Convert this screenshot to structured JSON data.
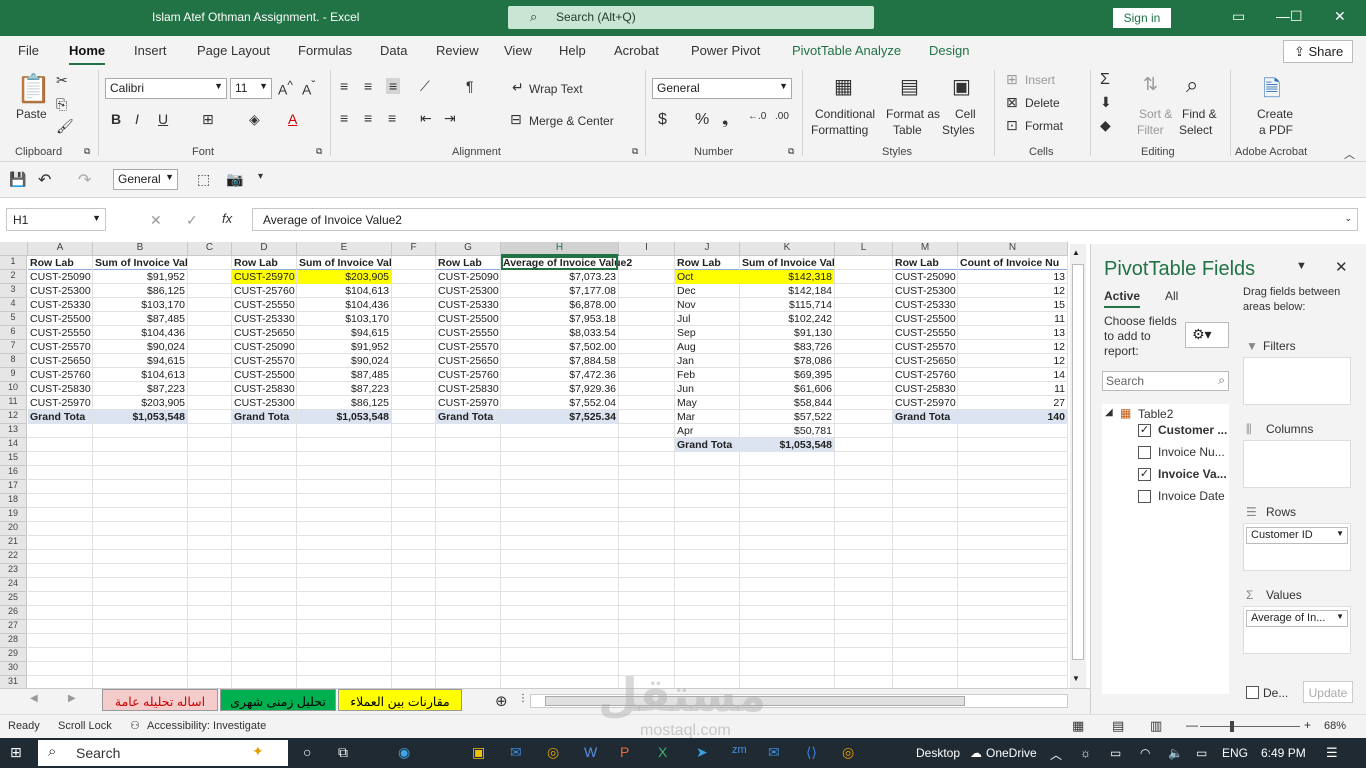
{
  "window": {
    "title": "Islam Atef Othman Assignment.  -  Excel",
    "search_placeholder": "Search (Alt+Q)",
    "signin": "Sign in"
  },
  "tabs": [
    "File",
    "Home",
    "Insert",
    "Page Layout",
    "Formulas",
    "Data",
    "Review",
    "View",
    "Help",
    "Acrobat",
    "Power Pivot",
    "PivotTable Analyze",
    "Design"
  ],
  "share": "Share",
  "ribbon": {
    "paste": "Paste",
    "clipboard": "Clipboard",
    "font_name": "Calibri",
    "font_size": "11",
    "font": "Font",
    "wrap_text": "Wrap Text",
    "merge_center": "Merge & Center",
    "alignment": "Alignment",
    "number_format": "General",
    "number": "Number",
    "conditional_1": "Conditional",
    "conditional_2": "Formatting",
    "format_as_1": "Format as",
    "format_as_2": "Table",
    "cell_styles_1": "Cell",
    "cell_styles_2": "Styles",
    "styles": "Styles",
    "insert": "Insert",
    "delete": "Delete",
    "format": "Format",
    "cells": "Cells",
    "sort_1": "Sort &",
    "sort_2": "Filter",
    "find_1": "Find &",
    "find_2": "Select",
    "editing": "Editing",
    "create_pdf_1": "Create",
    "create_pdf_2": "a PDF",
    "adobe": "Adobe Acrobat"
  },
  "qat": {
    "number_format": "General"
  },
  "formula_bar": {
    "name_box": "H1",
    "fx": "fx",
    "formula": "Average of Invoice Value2"
  },
  "columns": [
    "A",
    "B",
    "C",
    "D",
    "E",
    "F",
    "G",
    "H",
    "I",
    "J",
    "K",
    "L",
    "M",
    "N"
  ],
  "rows": [
    "1",
    "2",
    "3",
    "4",
    "5",
    "6",
    "7",
    "8",
    "9",
    "10",
    "11",
    "12",
    "13",
    "14",
    "15",
    "16",
    "17",
    "18",
    "19",
    "20",
    "21",
    "22",
    "23",
    "24",
    "25",
    "26",
    "27",
    "28",
    "29",
    "30",
    "31"
  ],
  "pivot1": {
    "h1": "Row Lab",
    "h2": "Sum of Invoice Value",
    "rows": [
      [
        "CUST-25090",
        "$91,952"
      ],
      [
        "CUST-25300",
        "$86,125"
      ],
      [
        "CUST-25330",
        "$103,170"
      ],
      [
        "CUST-25500",
        "$87,485"
      ],
      [
        "CUST-25550",
        "$104,436"
      ],
      [
        "CUST-25570",
        "$90,024"
      ],
      [
        "CUST-25650",
        "$94,615"
      ],
      [
        "CUST-25760",
        "$104,613"
      ],
      [
        "CUST-25830",
        "$87,223"
      ],
      [
        "CUST-25970",
        "$203,905"
      ]
    ],
    "total": [
      "Grand Tota",
      "$1,053,548"
    ]
  },
  "pivot2": {
    "h1": "Row Lab",
    "h2": "Sum of Invoice Value",
    "rows": [
      [
        "CUST-25970",
        "$203,905"
      ],
      [
        "CUST-25760",
        "$104,613"
      ],
      [
        "CUST-25550",
        "$104,436"
      ],
      [
        "CUST-25330",
        "$103,170"
      ],
      [
        "CUST-25650",
        "$94,615"
      ],
      [
        "CUST-25090",
        "$91,952"
      ],
      [
        "CUST-25570",
        "$90,024"
      ],
      [
        "CUST-25500",
        "$87,485"
      ],
      [
        "CUST-25830",
        "$87,223"
      ],
      [
        "CUST-25300",
        "$86,125"
      ]
    ],
    "total": [
      "Grand Tota",
      "$1,053,548"
    ]
  },
  "pivot3": {
    "h1": "Row Lab",
    "h2": "Average of Invoice Value2",
    "rows": [
      [
        "CUST-25090",
        "$7,073.23"
      ],
      [
        "CUST-25300",
        "$7,177.08"
      ],
      [
        "CUST-25330",
        "$6,878.00"
      ],
      [
        "CUST-25500",
        "$7,953.18"
      ],
      [
        "CUST-25550",
        "$8,033.54"
      ],
      [
        "CUST-25570",
        "$7,502.00"
      ],
      [
        "CUST-25650",
        "$7,884.58"
      ],
      [
        "CUST-25760",
        "$7,472.36"
      ],
      [
        "CUST-25830",
        "$7,929.36"
      ],
      [
        "CUST-25970",
        "$7,552.04"
      ]
    ],
    "total": [
      "Grand Tota",
      "$7,525.34"
    ]
  },
  "pivot4": {
    "h1": "Row Lab",
    "h2": "Sum of Invoice Value",
    "rows": [
      [
        "Oct",
        "$142,318"
      ],
      [
        "Dec",
        "$142,184"
      ],
      [
        "Nov",
        "$115,714"
      ],
      [
        "Jul",
        "$102,242"
      ],
      [
        "Sep",
        "$91,130"
      ],
      [
        "Aug",
        "$83,726"
      ],
      [
        "Jan",
        "$78,086"
      ],
      [
        "Feb",
        "$69,395"
      ],
      [
        "Jun",
        "$61,606"
      ],
      [
        "May",
        "$58,844"
      ],
      [
        "Mar",
        "$57,522"
      ],
      [
        "Apr",
        "$50,781"
      ]
    ],
    "total": [
      "Grand Tota",
      "$1,053,548"
    ]
  },
  "pivot5": {
    "h1": "Row Lab",
    "h2": "Count of Invoice Nu",
    "rows": [
      [
        "CUST-25090",
        "13"
      ],
      [
        "CUST-25300",
        "12"
      ],
      [
        "CUST-25330",
        "15"
      ],
      [
        "CUST-25500",
        "11"
      ],
      [
        "CUST-25550",
        "13"
      ],
      [
        "CUST-25570",
        "12"
      ],
      [
        "CUST-25650",
        "12"
      ],
      [
        "CUST-25760",
        "14"
      ],
      [
        "CUST-25830",
        "11"
      ],
      [
        "CUST-25970",
        "27"
      ]
    ],
    "total": [
      "Grand Tota",
      "140"
    ]
  },
  "sheets": [
    "اساله تحليله عامة",
    "تحليل زمنى شهرى",
    "مقارنات بين العملاء"
  ],
  "pivot_panel": {
    "title": "PivotTable Fields",
    "tab_active": "Active",
    "tab_all": "All",
    "choose_1": "Choose fields",
    "choose_2": "to add to",
    "choose_3": "report:",
    "drag_1": "Drag fields between",
    "drag_2": "areas below:",
    "search": "Search",
    "table": "Table2",
    "fields": [
      {
        "label": "Customer ...",
        "checked": true
      },
      {
        "label": "Invoice Nu...",
        "checked": false
      },
      {
        "label": "Invoice Va...",
        "checked": true
      },
      {
        "label": "Invoice Date",
        "checked": false
      }
    ],
    "filters": "Filters",
    "columns": "Columns",
    "rows": "Rows",
    "rows_item": "Customer ID",
    "values": "Values",
    "values_item": "Average of In...",
    "defer": "De...",
    "update": "Update"
  },
  "status": {
    "ready": "Ready",
    "scroll": "Scroll Lock",
    "accessibility": "Accessibility: Investigate",
    "zoom": "68%"
  },
  "taskbar": {
    "search": "Search",
    "desktop": "Desktop",
    "onedrive": "OneDrive",
    "lang": "ENG",
    "time": "6:49 PM"
  },
  "watermark": {
    "arabic": "مستقل",
    "latin": "mostaql.com"
  }
}
